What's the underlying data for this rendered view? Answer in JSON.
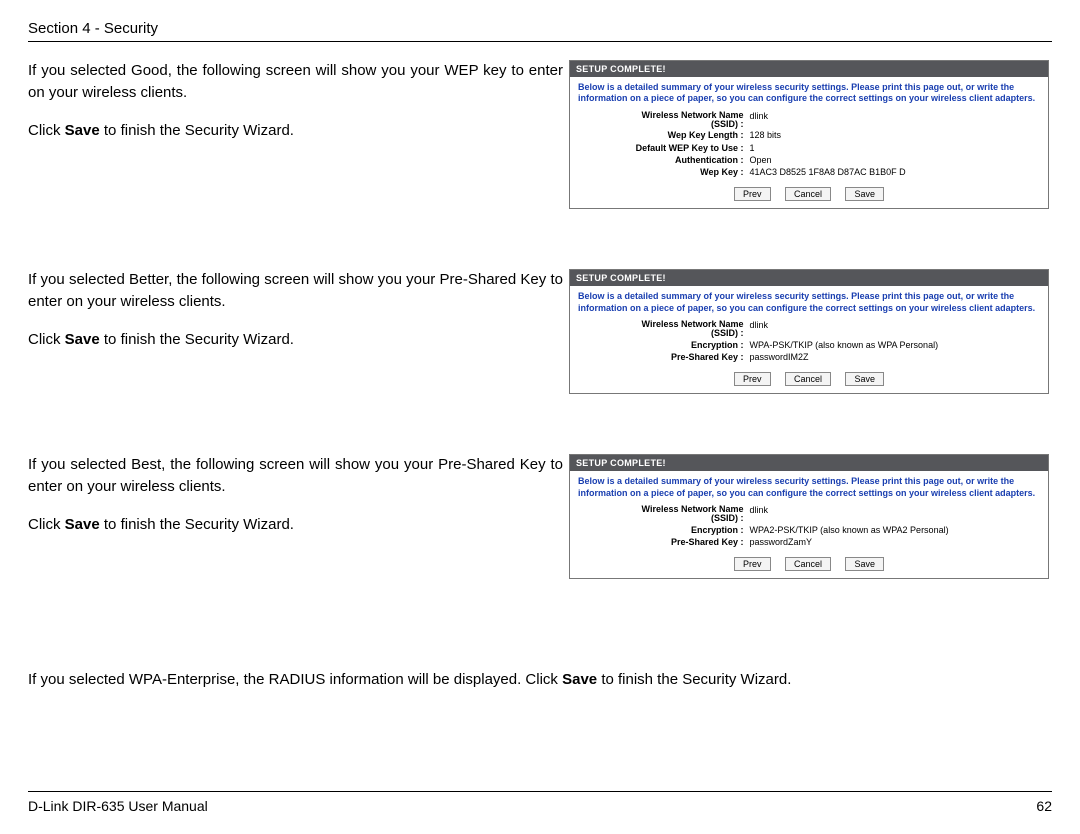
{
  "header": {
    "section": "Section 4 - Security"
  },
  "shared": {
    "bold_save": "Save",
    "click_prefix": "Click ",
    "click_suffix": " to finish the Security Wizard.",
    "panel_title": "SETUP COMPLETE!",
    "panel_note": "Below is a detailed summary of your wireless security settings. Please print this page out, or write the information on a piece of paper, so you can configure the correct settings on your wireless client adapters.",
    "btn_prev": "Prev",
    "btn_cancel": "Cancel",
    "btn_save": "Save"
  },
  "blocks": {
    "good": {
      "para1": "If you selected Good, the following screen will show you your WEP key to enter on your wireless clients.",
      "fields": [
        {
          "label": "Wireless Network Name (SSID) :",
          "value": "dlink",
          "twoline": true
        },
        {
          "label": "Wep Key Length :",
          "value": "128 bits"
        },
        {
          "label": "Default WEP Key to Use :",
          "value": "1"
        },
        {
          "label": "Authentication :",
          "value": "Open"
        },
        {
          "label": "Wep Key :",
          "value": "41AC3 D8525 1F8A8 D87AC B1B0F D"
        }
      ]
    },
    "better": {
      "para1": "If you selected Better, the following screen will show you your Pre-Shared Key to enter on your wireless clients.",
      "fields": [
        {
          "label": "Wireless Network Name (SSID) :",
          "value": "dlink",
          "twoline": true
        },
        {
          "label": "Encryption :",
          "value": "WPA-PSK/TKIP (also known as WPA Personal)"
        },
        {
          "label": "Pre-Shared Key :",
          "value": "passwordIM2Z"
        }
      ]
    },
    "best": {
      "para1": "If you selected Best, the following screen will show you your Pre-Shared Key to enter on your wireless clients.",
      "fields": [
        {
          "label": "Wireless Network Name (SSID) :",
          "value": "dlink",
          "twoline": true
        },
        {
          "label": "Encryption :",
          "value": "WPA2-PSK/TKIP (also known as WPA2 Personal)"
        },
        {
          "label": "Pre-Shared Key :",
          "value": "passwordZamY"
        }
      ]
    }
  },
  "wpa_line": {
    "prefix": "If you selected WPA-Enterprise, the RADIUS information will be displayed. Click ",
    "suffix": " to finish the Security Wizard."
  },
  "footer": {
    "left": "D-Link DIR-635 User Manual",
    "right": "62"
  }
}
